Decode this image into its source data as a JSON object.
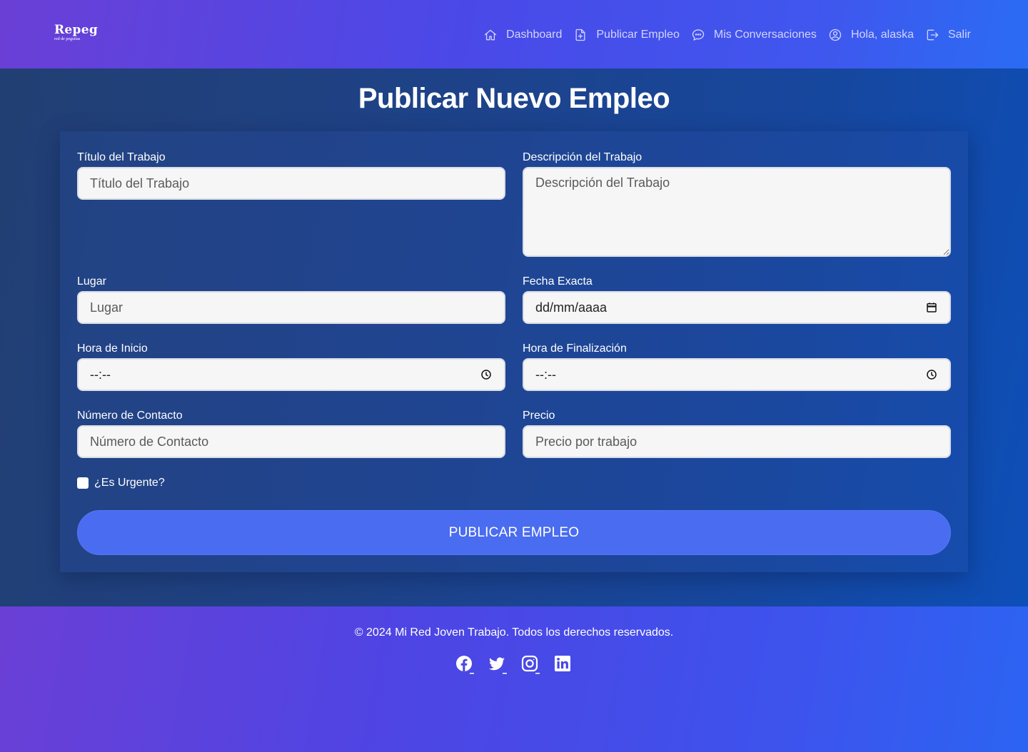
{
  "brand": {
    "logo_word": "Repeg",
    "logo_sub": "red de peguitas"
  },
  "nav": {
    "items": [
      {
        "label": "Dashboard",
        "icon": "home-icon"
      },
      {
        "label": "Publicar Empleo",
        "icon": "file-plus-icon"
      },
      {
        "label": "Mis Conversaciones",
        "icon": "chat-bubble-icon"
      },
      {
        "label": "Hola, alaska",
        "icon": "user-circle-icon"
      },
      {
        "label": "Salir",
        "icon": "logout-icon"
      }
    ]
  },
  "page": {
    "title": "Publicar Nuevo Empleo"
  },
  "form": {
    "titulo": {
      "label": "Título del Trabajo",
      "placeholder": "Título del Trabajo",
      "value": ""
    },
    "descripcion": {
      "label": "Descripción del Trabajo",
      "placeholder": "Descripción del Trabajo",
      "value": ""
    },
    "lugar": {
      "label": "Lugar",
      "placeholder": "Lugar",
      "value": ""
    },
    "fecha": {
      "label": "Fecha Exacta",
      "display": "dd/mm/aaaa",
      "icon": "calendar-icon"
    },
    "hora_inicio": {
      "label": "Hora de Inicio",
      "display": "--:--",
      "icon": "clock-icon"
    },
    "hora_fin": {
      "label": "Hora de Finalización",
      "display": "--:--",
      "icon": "clock-icon"
    },
    "contacto": {
      "label": "Número de Contacto",
      "placeholder": "Número de Contacto",
      "value": ""
    },
    "precio": {
      "label": "Precio",
      "placeholder": "Precio por trabajo",
      "value": ""
    },
    "urgente": {
      "label": "¿Es Urgente?",
      "checked": false
    },
    "submit_label": "PUBLICAR EMPLEO"
  },
  "footer": {
    "copyright": "© 2024 Mi Red Joven Trabajo. Todos los derechos reservados.",
    "social": [
      "facebook-icon",
      "twitter-icon",
      "instagram-icon",
      "linkedin-icon"
    ]
  },
  "colors": {
    "accent": "#4a6cf0",
    "header_start": "#6a3fd6",
    "header_end": "#2a6cf4",
    "nav_text": "#d2d4ff"
  }
}
